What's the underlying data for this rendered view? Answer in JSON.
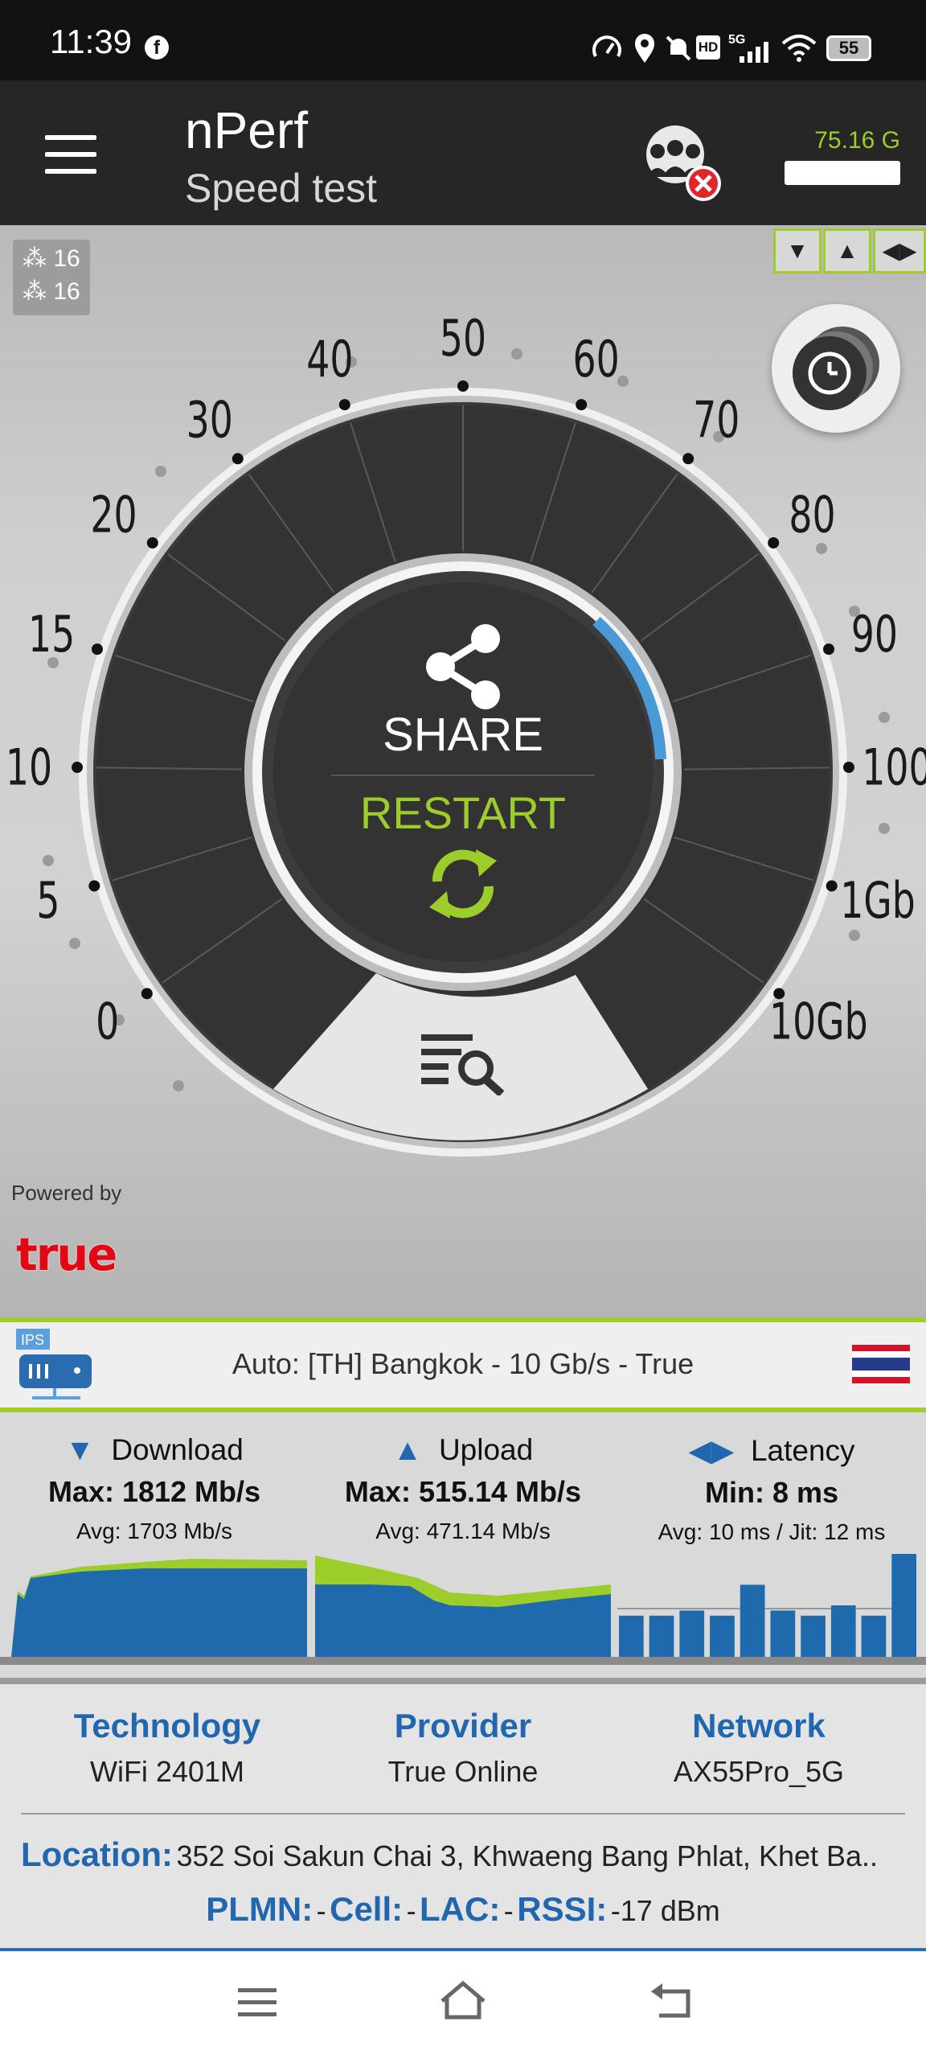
{
  "status_bar": {
    "time": "11:39",
    "battery": "55",
    "icons": [
      "facebook-icon",
      "speedometer-icon",
      "location-icon",
      "mute-icon",
      "hd-icon",
      "5g-signal-icon",
      "wifi-icon",
      "battery-icon"
    ]
  },
  "app_bar": {
    "title": "nPerf",
    "subtitle": "Speed test",
    "data_used": "75.16 G"
  },
  "gauge": {
    "threads_down": "16",
    "threads_up": "16",
    "scale": [
      {
        "label": "0",
        "value": 0
      },
      {
        "label": "5",
        "value": 5
      },
      {
        "label": "10",
        "value": 10
      },
      {
        "label": "15",
        "value": 15
      },
      {
        "label": "20",
        "value": 20
      },
      {
        "label": "30",
        "value": 30
      },
      {
        "label": "40",
        "value": 40
      },
      {
        "label": "50",
        "value": 50
      },
      {
        "label": "60",
        "value": 60
      },
      {
        "label": "70",
        "value": 70
      },
      {
        "label": "80",
        "value": 80
      },
      {
        "label": "90",
        "value": 90
      },
      {
        "label": "100",
        "value": 100
      },
      {
        "label": "1Gb",
        "value": 1000
      },
      {
        "label": "10Gb",
        "value": 10000
      }
    ],
    "share_label": "SHARE",
    "restart_label": "RESTART",
    "accent_green": "#9ccd2a",
    "accent_blue": "#4a9ad8"
  },
  "powered_by": {
    "label": "Powered by",
    "brand": "true"
  },
  "server": {
    "badge": "IPS",
    "text": "Auto: [TH] Bangkok - 10 Gb/s - True"
  },
  "results": {
    "download": {
      "title": "Download",
      "max": "Max: 1812 Mb/s",
      "avg": "Avg: 1703 Mb/s"
    },
    "upload": {
      "title": "Upload",
      "max": "Max: 515.14 Mb/s",
      "avg": "Avg: 471.14 Mb/s"
    },
    "latency": {
      "title": "Latency",
      "min": "Min: 8 ms",
      "avg": "Avg: 10 ms / Jit: 12 ms"
    },
    "latency_bars": [
      0.4,
      0.4,
      0.45,
      0.4,
      0.7,
      0.45,
      0.4,
      0.5,
      0.4,
      1.0
    ]
  },
  "info": {
    "technology_label": "Technology",
    "technology_value": "WiFi 2401M",
    "provider_label": "Provider",
    "provider_value": "True Online",
    "network_label": "Network",
    "network_value": "AX55Pro_5G",
    "location_label": "Location:",
    "location_value": "352 Soi Sakun Chai 3, Khwaeng Bang Phlat, Khet Ba..",
    "plmn_label": "PLMN:",
    "plmn_value": "-",
    "cell_label": "Cell:",
    "cell_value": "-",
    "lac_label": "LAC:",
    "lac_value": "-",
    "rssi_label": "RSSI:",
    "rssi_value": "-17 dBm"
  }
}
